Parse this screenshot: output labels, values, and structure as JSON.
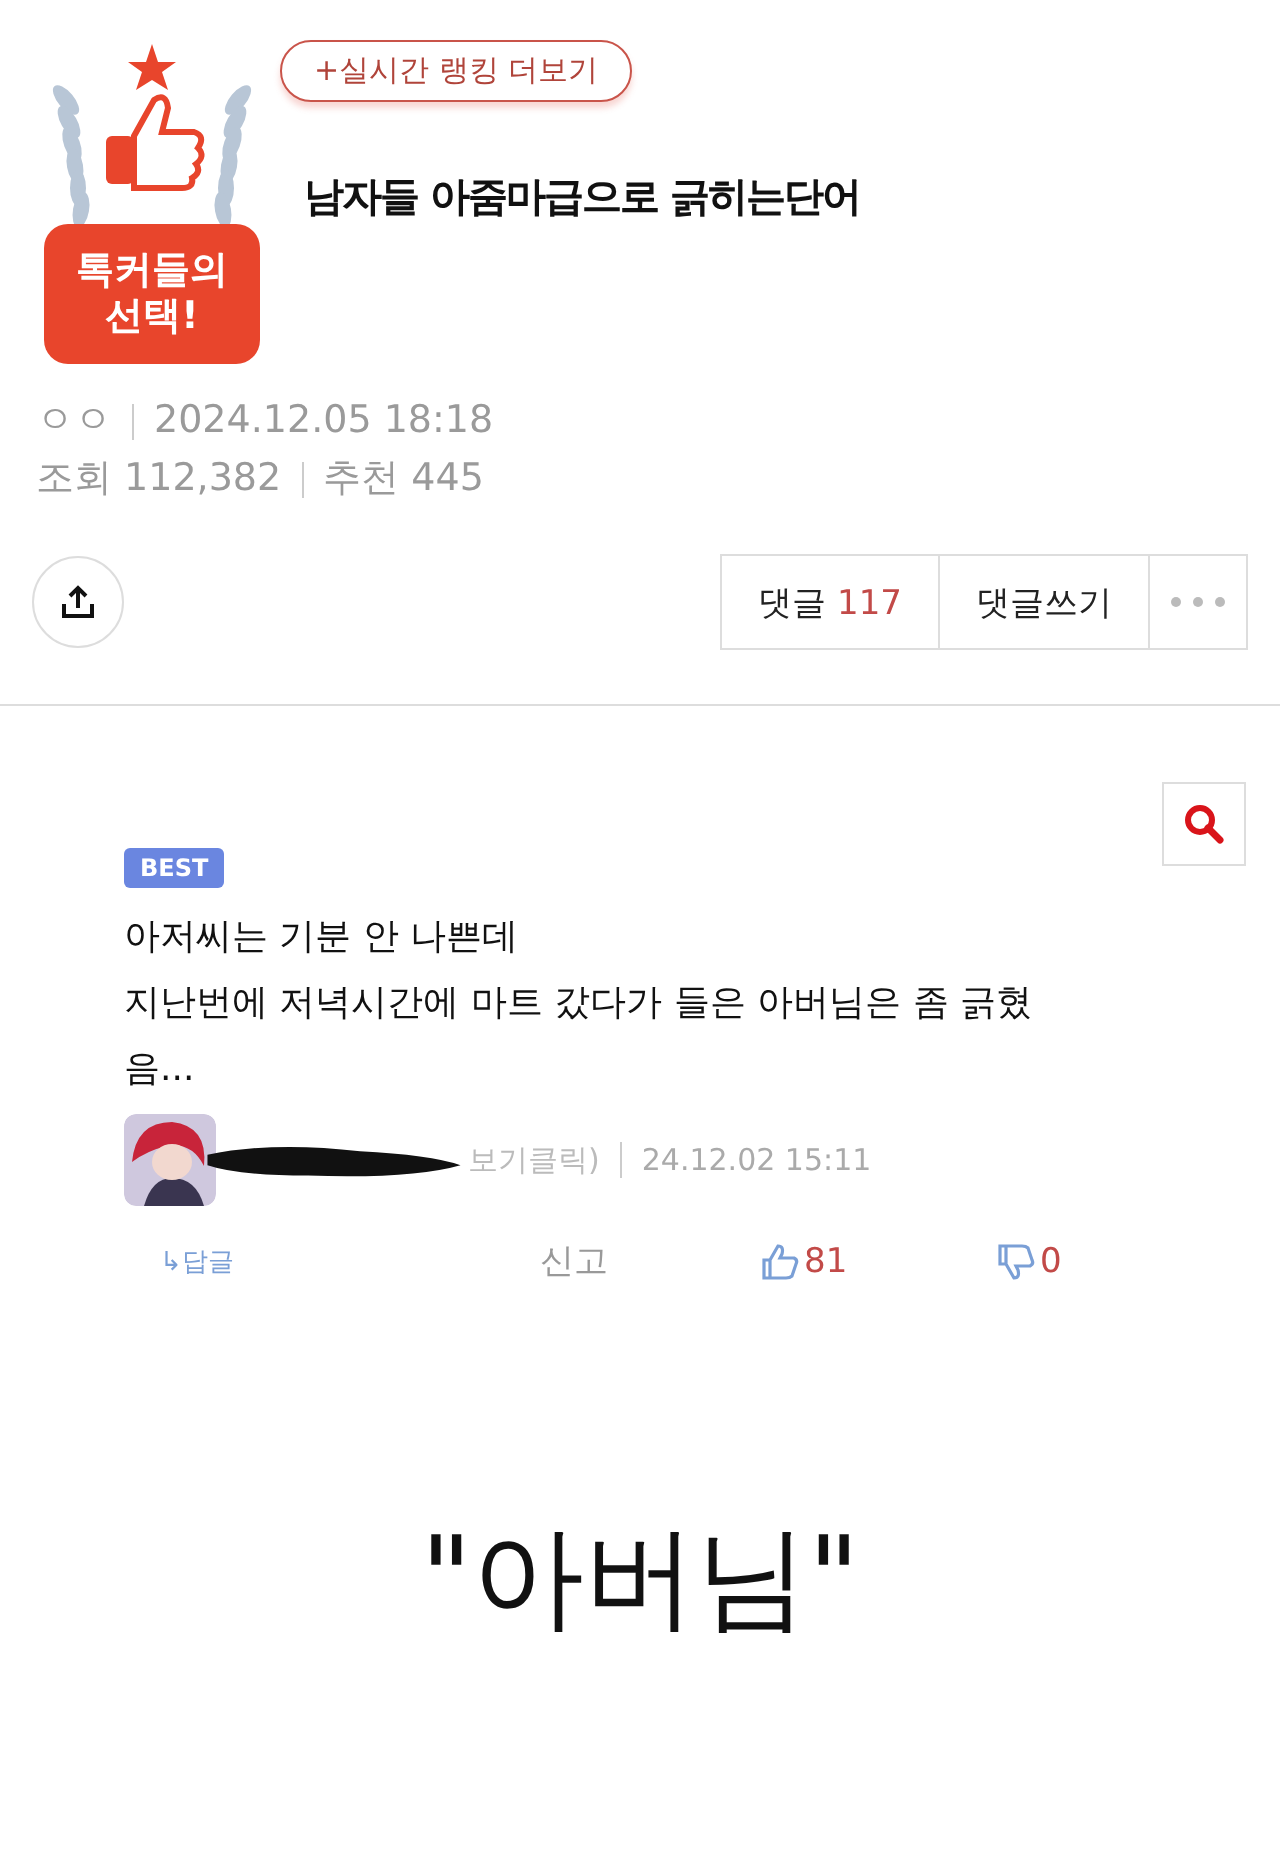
{
  "badge": {
    "line_1": "톡커들의",
    "line_2": "선택!"
  },
  "ranking_button": "+실시간 랭킹 더보기",
  "title": "남자들 아줌마급으로 긁히는단어",
  "meta": {
    "author": "ㅇㅇ",
    "date": "2024.12.05 18:18",
    "views_label": "조회",
    "views": "112,382",
    "likes_label": "추천",
    "likes": "445"
  },
  "actions": {
    "comments_label": "댓글",
    "comments_count": "117",
    "write": "댓글쓰기"
  },
  "comment": {
    "tag": "BEST",
    "lines": [
      "아저씨는 기분 안 나쁜데",
      "지난번에 저녁시간에 마트 갔다가 들은 아버님은 좀 긁혔",
      "음..."
    ],
    "author": "보기클릭)",
    "date": "24.12.02 15:11",
    "reply": "↳답글",
    "report": "신고",
    "up": "81",
    "down": "0"
  },
  "caption": "\"아버님\""
}
